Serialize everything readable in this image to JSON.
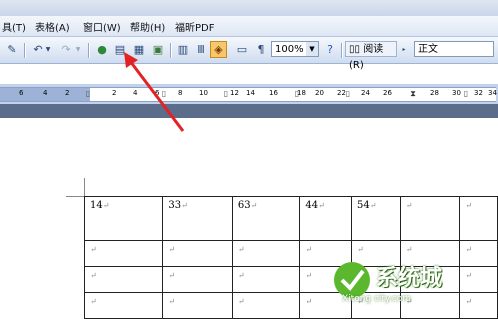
{
  "menubar": {
    "items": [
      "具(T)",
      "表格(A)",
      "窗口(W)",
      "帮助(H)",
      "福昕PDF"
    ]
  },
  "toolbar": {
    "zoom_value": "100%",
    "read_button_label": "阅读(R)",
    "style_value": "正文"
  },
  "ruler": {
    "numbers": [
      "6",
      "4",
      "2",
      "2",
      "4",
      "6",
      "8",
      "10",
      "12",
      "14",
      "16",
      "18",
      "20",
      "22",
      "24",
      "26",
      "28",
      "30",
      "32",
      "34"
    ]
  },
  "table": {
    "rows": [
      [
        "14",
        "33",
        "63",
        "44",
        "54",
        "",
        ""
      ],
      [
        "",
        "",
        "",
        "",
        "",
        "",
        ""
      ],
      [
        "",
        "",
        "",
        "",
        "",
        "",
        ""
      ],
      [
        "",
        "",
        "",
        "",
        "",
        "",
        ""
      ]
    ]
  },
  "watermark": {
    "text": "系统城",
    "domain": "Xitong city.com"
  },
  "colors": {
    "accent_arrow": "#e32323",
    "highlight_button": "#f6c86b",
    "watermark_green": "#5bb82e"
  }
}
